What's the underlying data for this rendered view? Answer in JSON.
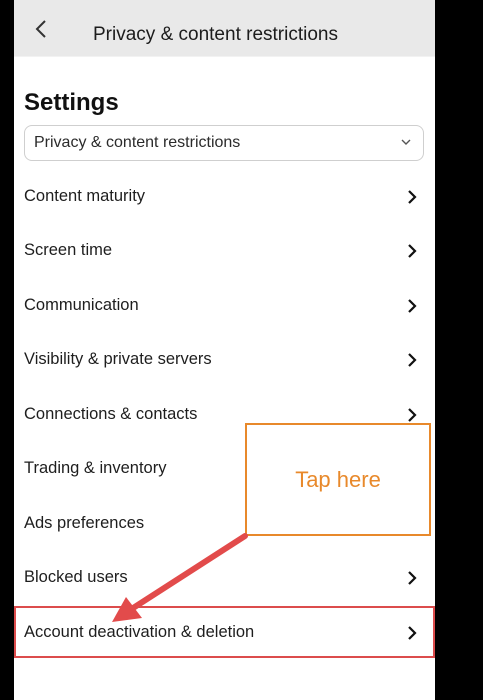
{
  "header": {
    "title": "Privacy & content restrictions",
    "back_icon": "chevron-left-icon"
  },
  "page": {
    "title": "Settings"
  },
  "dropdown": {
    "selected": "Privacy & content restrictions",
    "icon": "chevron-down-icon"
  },
  "menu": {
    "items": [
      {
        "label": "Content maturity"
      },
      {
        "label": "Screen time"
      },
      {
        "label": "Communication"
      },
      {
        "label": "Visibility & private servers"
      },
      {
        "label": "Connections & contacts"
      },
      {
        "label": "Trading & inventory"
      },
      {
        "label": "Ads preferences"
      },
      {
        "label": "Blocked users"
      },
      {
        "label": "Account deactivation & deletion"
      }
    ]
  },
  "annotation": {
    "callout_text": "Tap here",
    "callout_color": "#e8892b",
    "highlight_color": "#dc4c4c"
  }
}
